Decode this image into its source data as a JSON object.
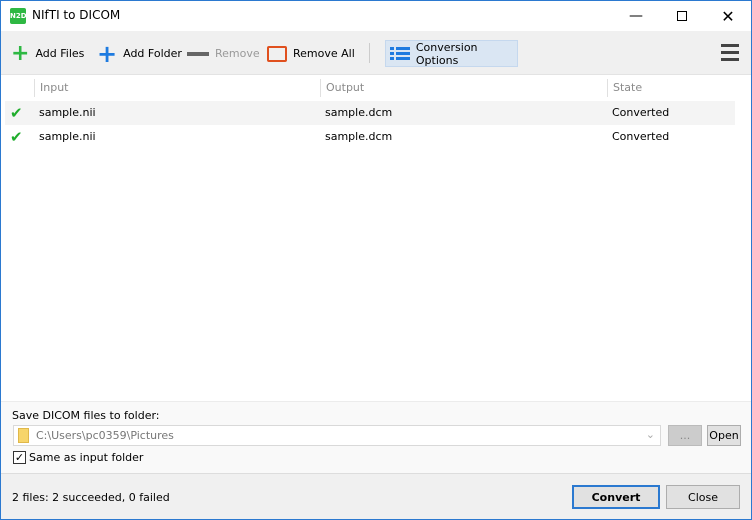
{
  "window": {
    "title": "NIfTI to DICOM",
    "icon_text": "N2D"
  },
  "toolbar": {
    "add_files": "Add Files",
    "add_folder": "Add Folder",
    "remove": "Remove",
    "remove_all": "Remove All",
    "conversion_options": "Conversion Options"
  },
  "table": {
    "columns": [
      "Input",
      "Output",
      "State"
    ],
    "rows": [
      {
        "input": "sample.nii",
        "output": "sample.dcm",
        "state": "Converted"
      },
      {
        "input": "sample.nii",
        "output": "sample.dcm",
        "state": "Converted"
      }
    ]
  },
  "output": {
    "label": "Save DICOM files to folder:",
    "path": "C:\\Users\\pc0359\\Pictures",
    "browse": "...",
    "open": "Open",
    "same_as_input": "Same as input folder",
    "same_as_input_checked": true
  },
  "footer": {
    "status": "2 files: 2 succeeded, 0 failed",
    "convert": "Convert",
    "close": "Close"
  },
  "colors": {
    "accent": "#2b79d0",
    "check": "#1fad2c",
    "remove_all": "#e0501e"
  }
}
